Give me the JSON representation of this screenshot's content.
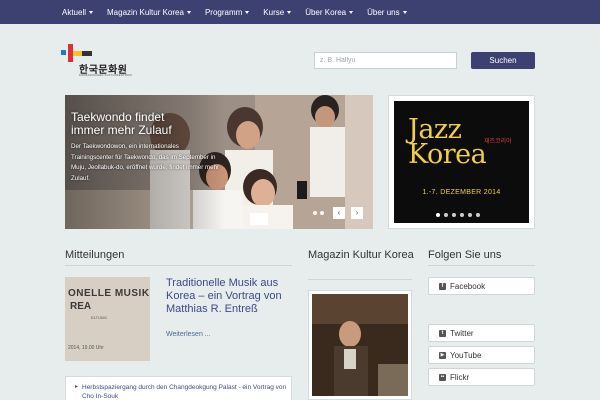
{
  "nav": {
    "items": [
      {
        "label": "Aktuell"
      },
      {
        "label": "Magazin Kultur Korea"
      },
      {
        "label": "Programm"
      },
      {
        "label": "Kurse"
      },
      {
        "label": "Über Korea"
      },
      {
        "label": "Über uns"
      }
    ]
  },
  "header": {
    "logo_text": "한국문화원",
    "logo_subtext": "KOREANISCHES KULTURZENTRUM",
    "search": {
      "placeholder": "z. B. Hallyu",
      "button_label": "Suchen"
    }
  },
  "slider": {
    "title": "Taekwondo findet immer mehr Zulauf",
    "text": "Der Taekwondowon, ein internationales Trainingscenter für Taekwondo, das im September in Muju, Jeollabuk-do, eröffnet wurde, findet immer mehr Zulauf.",
    "prev_label": "‹",
    "next_label": "›"
  },
  "jazz": {
    "word": "Jazz\nKorea",
    "korean": "재즈코리아",
    "date": "1.-7. DEZEMBER 2014"
  },
  "mitteilungen": {
    "heading": "Mitteilungen",
    "thumb_line1": "ONELLE MUSIK",
    "thumb_line2": "REA",
    "thumb_line3": "ELTUNG",
    "thumb_line4": "2014, 19.00 Uhr",
    "featured_title": "Traditionelle Musik aus Korea – ein Vortrag von Matthias R. Entreß",
    "read_more": "Weiterlesen ...",
    "list": [
      "Herbstspaziergang durch den Changdeokgung Palast - ein Vortrag von Cho In-Souk"
    ]
  },
  "magazin": {
    "heading": "Magazin Kultur Korea"
  },
  "follow": {
    "heading": "Folgen Sie uns",
    "items": [
      {
        "label": "Facebook",
        "icon": "f"
      },
      {
        "label": "Twitter",
        "icon": "t"
      },
      {
        "label": "YouTube",
        "icon": "▶"
      },
      {
        "label": "Flickr",
        "icon": "••"
      }
    ]
  },
  "colors": {
    "nav_bg": "#3c4172",
    "link": "#3c4a8a",
    "jazz_yellow": "#f0cf47"
  }
}
